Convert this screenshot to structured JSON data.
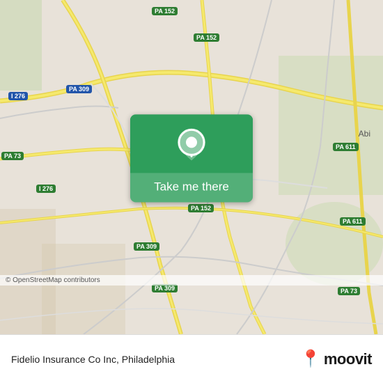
{
  "map": {
    "background_color": "#e0d9ce",
    "center": {
      "lat": 40.12,
      "lng": -75.12
    }
  },
  "button": {
    "label": "Take me there",
    "bg_color": "#2e9e5b"
  },
  "road_badges": [
    {
      "id": "i276-left",
      "label": "I 276",
      "type": "blue",
      "top": "132",
      "left": "18"
    },
    {
      "id": "pa309-left",
      "label": "PA 309",
      "type": "green",
      "top": "270",
      "left": "58"
    },
    {
      "id": "pa73-left",
      "label": "PA 73",
      "type": "green",
      "top": "220",
      "left": "2"
    },
    {
      "id": "i276-mid",
      "label": "I 276",
      "type": "blue",
      "top": "132",
      "left": "100"
    },
    {
      "id": "pa152-top1",
      "label": "PA 152",
      "type": "green",
      "top": "12",
      "left": "215"
    },
    {
      "id": "pa152-top2",
      "label": "PA 152",
      "type": "green",
      "top": "52",
      "left": "280"
    },
    {
      "id": "pa152-mid",
      "label": "PA 152",
      "type": "green",
      "top": "295",
      "left": "275"
    },
    {
      "id": "pa309-mid",
      "label": "PA 309",
      "type": "green",
      "top": "350",
      "left": "195"
    },
    {
      "id": "pa309-bot",
      "label": "PA 309",
      "type": "green",
      "top": "410",
      "left": "220"
    },
    {
      "id": "pa611-top",
      "label": "PA 611",
      "type": "green",
      "top": "210",
      "left": "480"
    },
    {
      "id": "pa611-bot",
      "label": "PA 611",
      "type": "green",
      "top": "315",
      "left": "490"
    },
    {
      "id": "pa73-bot",
      "label": "PA 73",
      "type": "green",
      "top": "415",
      "left": "488"
    }
  ],
  "info_bar": {
    "copyright": "© OpenStreetMap contributors",
    "location_name": "Fidelio Insurance Co Inc",
    "city": "Philadelphia"
  },
  "moovit": {
    "logo_icon": "📍",
    "text": "moovit"
  },
  "place_label": {
    "text": "Abi"
  }
}
